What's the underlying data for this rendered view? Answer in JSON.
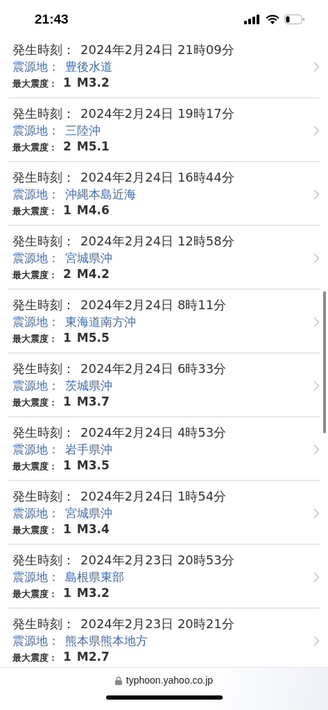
{
  "status_bar": {
    "time": "21:43"
  },
  "quakes": [
    {
      "time_label": "発生時刻：",
      "time": "2024年2月24日 21時09分",
      "place_label": "震源地：",
      "place": "豊後水道",
      "intensity_label": "最大震度：",
      "intensity": "1",
      "magnitude": "M3.2"
    },
    {
      "time_label": "発生時刻：",
      "time": "2024年2月24日 19時17分",
      "place_label": "震源地：",
      "place": "三陸沖",
      "intensity_label": "最大震度：",
      "intensity": "2",
      "magnitude": "M5.1"
    },
    {
      "time_label": "発生時刻：",
      "time": "2024年2月24日 16時44分",
      "place_label": "震源地：",
      "place": "沖縄本島近海",
      "intensity_label": "最大震度：",
      "intensity": "1",
      "magnitude": "M4.6"
    },
    {
      "time_label": "発生時刻：",
      "time": "2024年2月24日 12時58分",
      "place_label": "震源地：",
      "place": "宮城県沖",
      "intensity_label": "最大震度：",
      "intensity": "2",
      "magnitude": "M4.2"
    },
    {
      "time_label": "発生時刻：",
      "time": "2024年2月24日 8時11分",
      "place_label": "震源地：",
      "place": "東海道南方沖",
      "intensity_label": "最大震度：",
      "intensity": "1",
      "magnitude": "M5.5"
    },
    {
      "time_label": "発生時刻：",
      "time": "2024年2月24日 6時33分",
      "place_label": "震源地：",
      "place": "茨城県沖",
      "intensity_label": "最大震度：",
      "intensity": "1",
      "magnitude": "M3.7"
    },
    {
      "time_label": "発生時刻：",
      "time": "2024年2月24日 4時53分",
      "place_label": "震源地：",
      "place": "岩手県沖",
      "intensity_label": "最大震度：",
      "intensity": "1",
      "magnitude": "M3.5"
    },
    {
      "time_label": "発生時刻：",
      "time": "2024年2月24日 1時54分",
      "place_label": "震源地：",
      "place": "宮城県沖",
      "intensity_label": "最大震度：",
      "intensity": "1",
      "magnitude": "M3.4"
    },
    {
      "time_label": "発生時刻：",
      "time": "2024年2月23日 20時53分",
      "place_label": "震源地：",
      "place": "島根県東部",
      "intensity_label": "最大震度：",
      "intensity": "1",
      "magnitude": "M3.2"
    },
    {
      "time_label": "発生時刻：",
      "time": "2024年2月23日 20時21分",
      "place_label": "震源地：",
      "place": "熊本県熊本地方",
      "intensity_label": "最大震度：",
      "intensity": "1",
      "magnitude": "M2.7"
    }
  ],
  "address_bar": {
    "url": "typhoon.yahoo.co.jp"
  }
}
